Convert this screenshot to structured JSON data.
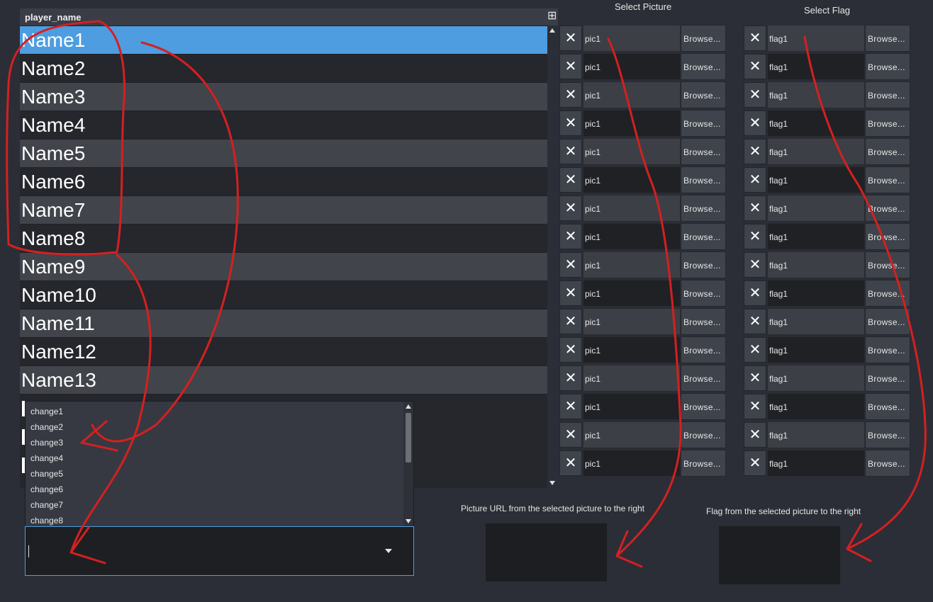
{
  "table": {
    "column_header": "player_name",
    "rows": [
      "Name1",
      "Name2",
      "Name3",
      "Name4",
      "Name5",
      "Name6",
      "Name7",
      "Name8",
      "Name9",
      "Name10",
      "Name11",
      "Name12",
      "Name13"
    ],
    "selected_index": 0
  },
  "dropdown": {
    "items": [
      "change1",
      "change2",
      "change3",
      "change4",
      "change5",
      "change6",
      "change7",
      "change8"
    ]
  },
  "combo": {
    "value": ""
  },
  "picture_column": {
    "title": "Select Picture",
    "value": "pic1",
    "browse_label": "Browse...",
    "row_count": 16
  },
  "flag_column": {
    "title": "Select Flag",
    "value": "flag1",
    "browse_label": "Browse...",
    "row_count": 16
  },
  "picture_preview": {
    "caption": "Picture URL from the selected picture to the right"
  },
  "flag_preview": {
    "caption": "Flag from the selected picture to the right"
  },
  "colors": {
    "background": "#2b2e36",
    "selected_row": "#4e9de0",
    "annotation": "#d42020"
  },
  "icons": {
    "clear": "close-icon",
    "header_corner": "column-menu-icon",
    "combo_arrow": "chevron-down-icon"
  }
}
